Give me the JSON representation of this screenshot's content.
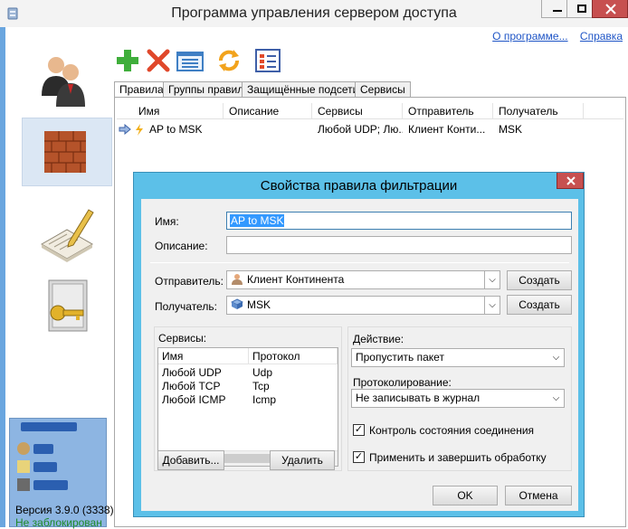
{
  "window": {
    "title": "Программа управления сервером доступа",
    "links": [
      "О программе...",
      "Справка"
    ]
  },
  "status_panel": {
    "version": "Версия 3.9.0 (3338)",
    "lock_status": "Не заблокирован"
  },
  "toolbar": {
    "icons": [
      "add-icon",
      "delete-icon",
      "properties-icon",
      "refresh-icon",
      "columns-icon"
    ]
  },
  "tabs": [
    "Правила",
    "Группы правил",
    "Защищённые подсети",
    "Сервисы"
  ],
  "rules_table": {
    "columns": [
      "Имя",
      "Описание",
      "Сервисы",
      "Отправитель",
      "Получатель"
    ],
    "rows": [
      {
        "name": "AP to MSK",
        "description": "",
        "services": "Любой UDP; Лю...",
        "sender": "Клиент Конти...",
        "receiver": "MSK"
      }
    ]
  },
  "dialog": {
    "title": "Свойства правила фильтрации",
    "name_label": "Имя:",
    "name_value": "AP to MSK",
    "description_label": "Описание:",
    "description_value": "",
    "sender_label": "Отправитель:",
    "sender_value": "Клиент Континента",
    "receiver_label": "Получатель:",
    "receiver_value": "MSK",
    "create_label": "Создать",
    "services_label": "Сервисы:",
    "services_columns": [
      "Имя",
      "Протокол"
    ],
    "services": [
      {
        "name": "Любой UDP",
        "protocol": "Udp"
      },
      {
        "name": "Любой TCP",
        "protocol": "Tcp"
      },
      {
        "name": "Любой ICMP",
        "protocol": "Icmp"
      }
    ],
    "add_label": "Добавить...",
    "remove_label": "Удалить",
    "action_label": "Действие:",
    "action_value": "Пропустить пакет",
    "logging_label": "Протоколирование:",
    "logging_value": "Не записывать в журнал",
    "stateful_label": "Контроль состояния соединения",
    "stateful_checked": true,
    "finish_label": "Применить и завершить обработку",
    "finish_checked": true,
    "ok_label": "OK",
    "cancel_label": "Отмена"
  },
  "colors": {
    "accent": "#5cc0e8",
    "link": "#1f55c6",
    "status_ok": "#1f8a2b",
    "selection": "#3399ff"
  }
}
